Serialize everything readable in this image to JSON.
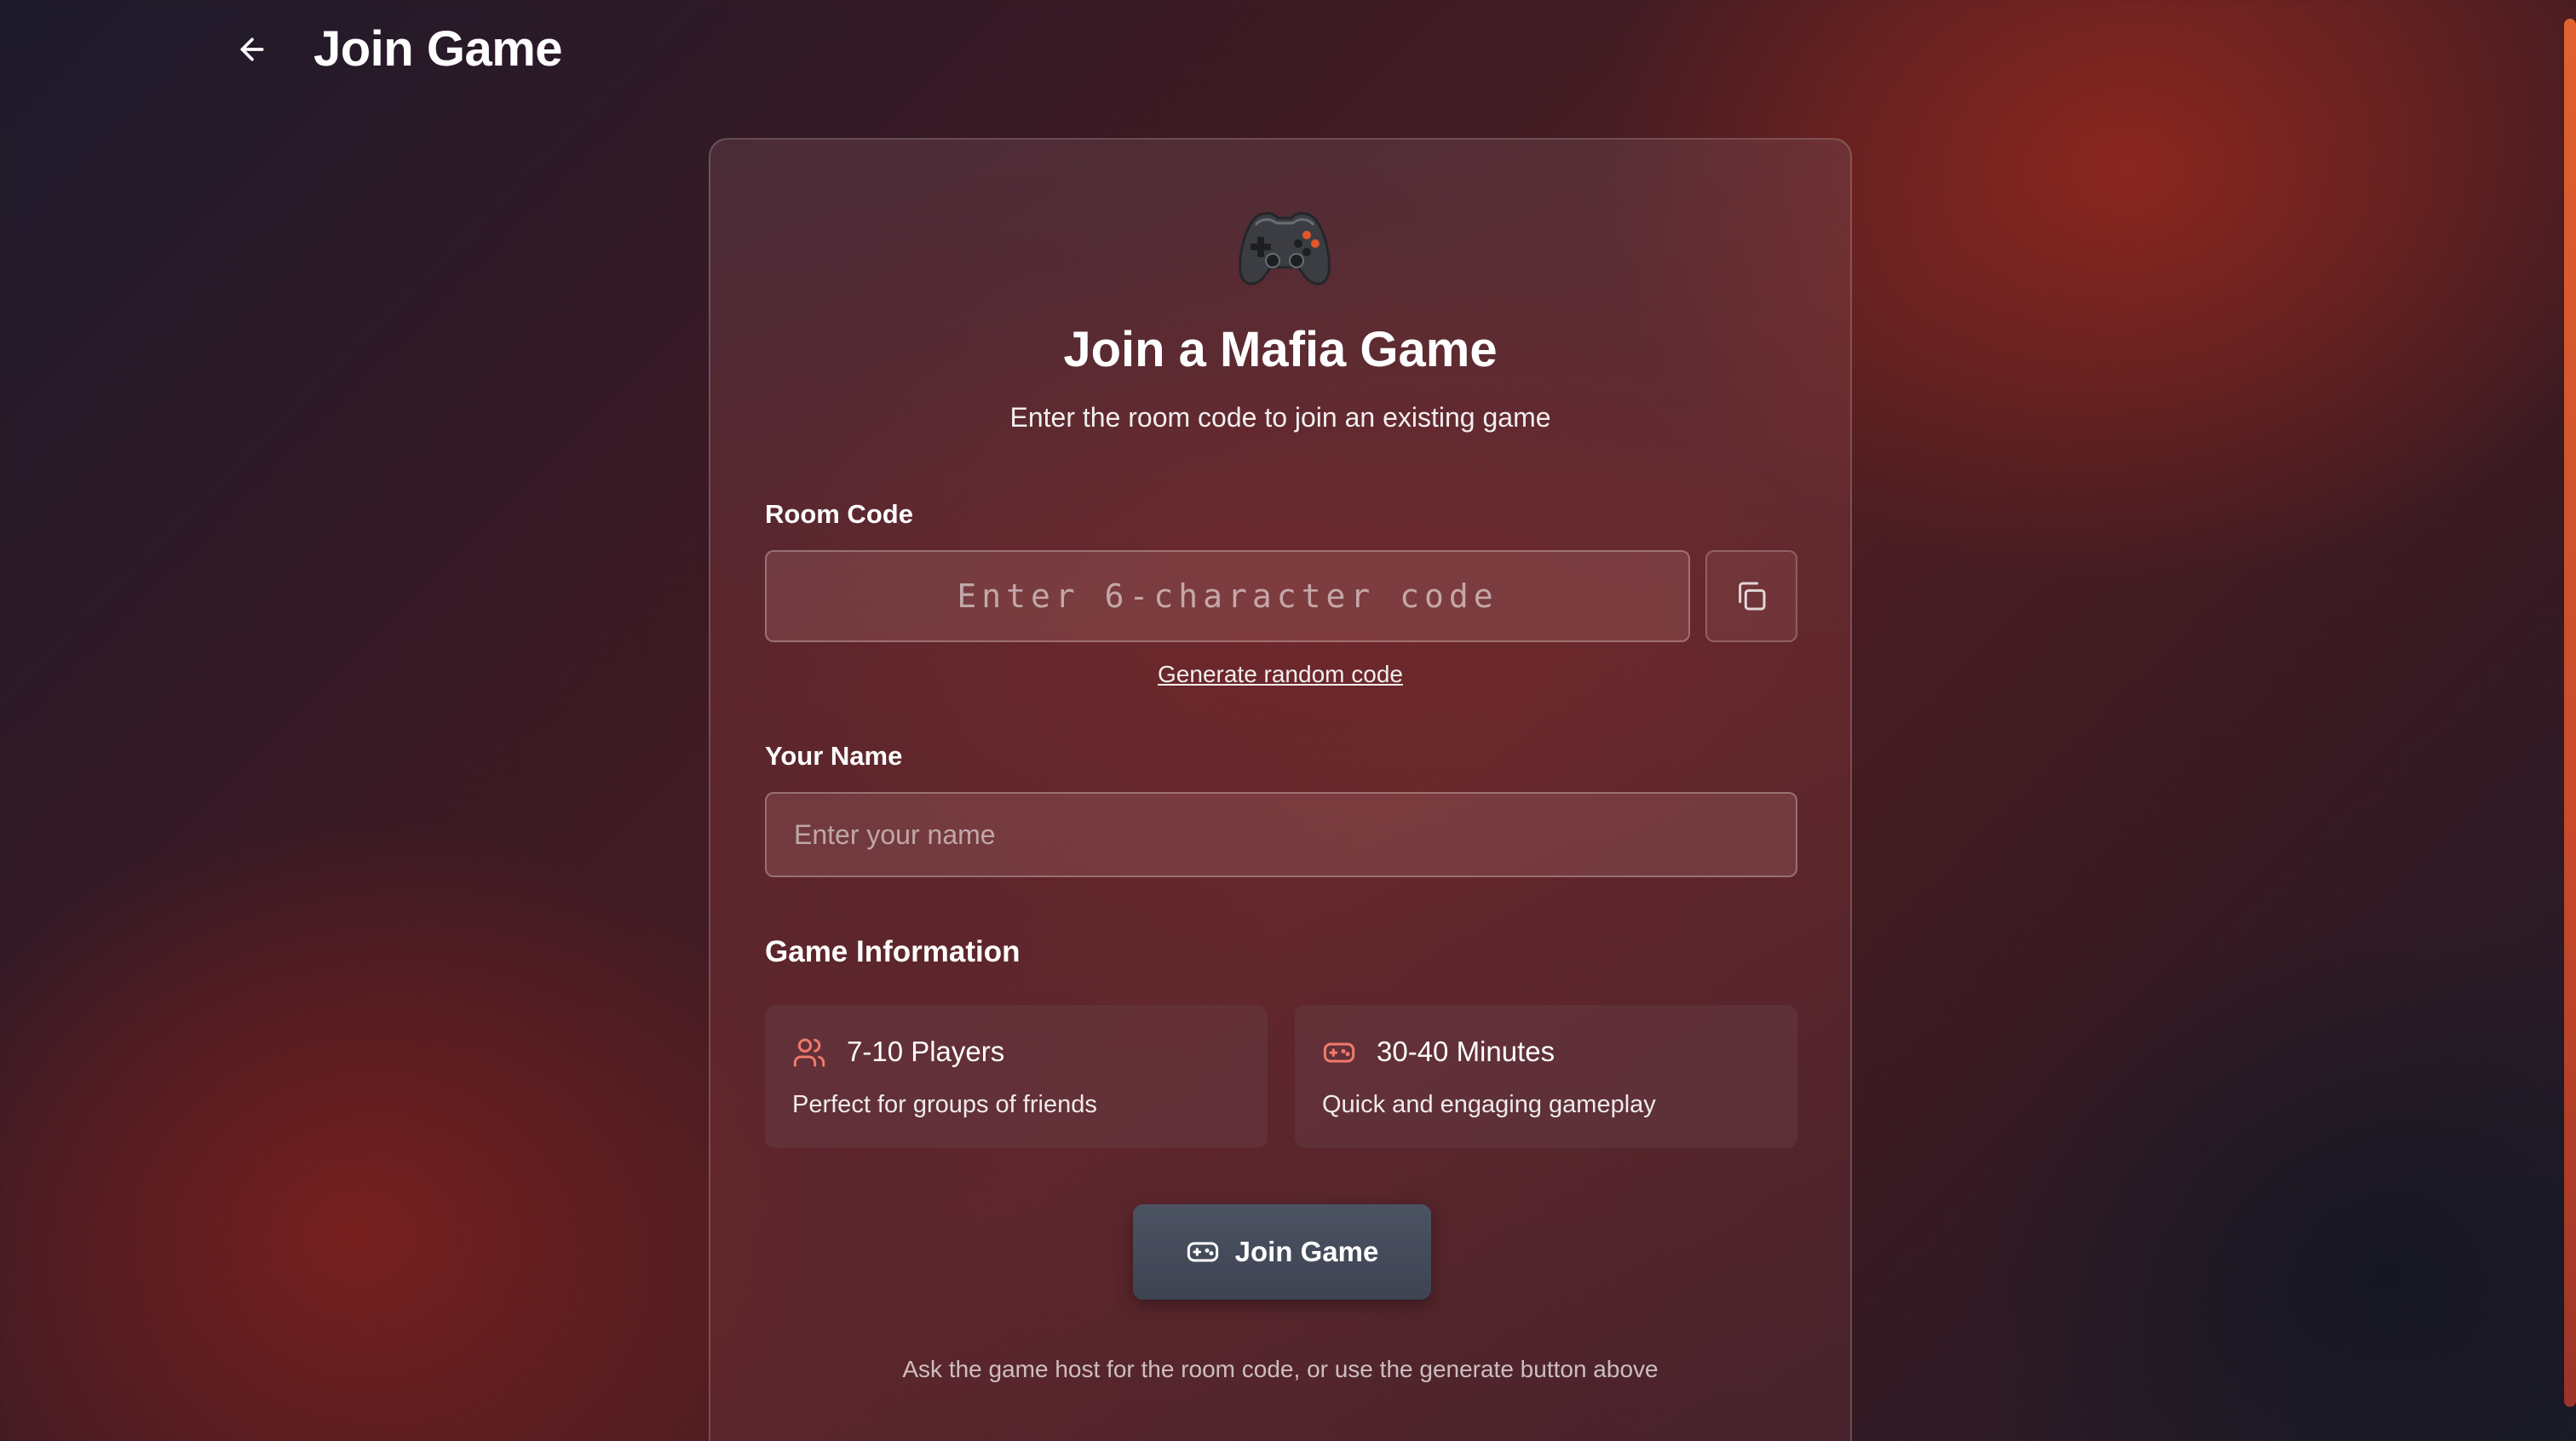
{
  "header": {
    "title": "Join Game",
    "back_icon": "arrow-left-icon"
  },
  "card": {
    "icon": "game-controller-icon",
    "title": "Join a Mafia Game",
    "subtitle": "Enter the room code to join an existing game",
    "room_code": {
      "label": "Room Code",
      "placeholder": "Enter 6-character code",
      "value": "",
      "copy_icon": "copy-icon",
      "generate_link": "Generate random code"
    },
    "name": {
      "label": "Your Name",
      "placeholder": "Enter your name",
      "value": ""
    },
    "game_info": {
      "title": "Game Information",
      "items": [
        {
          "icon": "users-icon",
          "title": "7-10 Players",
          "description": "Perfect for groups of friends"
        },
        {
          "icon": "gamepad-icon",
          "title": "30-40 Minutes",
          "description": "Quick and engaging gameplay"
        }
      ]
    },
    "join_button": {
      "label": "Join Game",
      "icon": "gamepad-icon"
    },
    "footer_hint": "Ask the game host for the room code, or use the generate button above"
  },
  "colors": {
    "accent_icon": "#f07a6a",
    "button_bg": "#454b5a",
    "scrollbar": "#e0622e"
  }
}
